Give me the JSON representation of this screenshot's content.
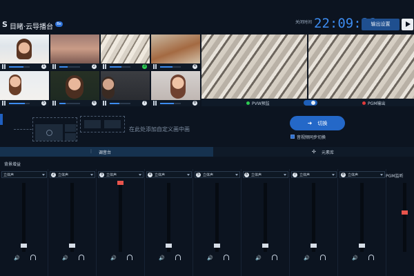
{
  "header": {
    "app_title": "目睹·云导播台",
    "beta_badge": "Be",
    "clock_label": "关闭时间",
    "clock_time": "22:09:32",
    "output_settings": "输出设置"
  },
  "monitors": {
    "pvw_label": "PVW预监",
    "pgm_label": "PGM输出"
  },
  "transition": {
    "hint": "在此处添加自定义画中画",
    "switch_label": "切换",
    "sync_label": "音视频同步切换"
  },
  "tabs": {
    "mixer": "调音台",
    "library": "元素库"
  },
  "mixer": {
    "bg_gain": "背景增益",
    "pgm_monitor": "PGM监听",
    "channels": [
      {
        "num": "1",
        "label": "立体声"
      },
      {
        "num": "2",
        "label": "立体声"
      },
      {
        "num": "3",
        "label": "立体声"
      },
      {
        "num": "4",
        "label": "立体声"
      },
      {
        "num": "5",
        "label": "立体声"
      },
      {
        "num": "6",
        "label": "立体声"
      },
      {
        "num": "7",
        "label": "立体声"
      },
      {
        "num": "8",
        "label": "立体声"
      }
    ]
  },
  "sources": [
    {
      "num": "1"
    },
    {
      "num": "2"
    },
    {
      "num": "3"
    },
    {
      "num": "4"
    },
    {
      "num": "5"
    },
    {
      "num": "6"
    },
    {
      "num": "7"
    },
    {
      "num": "8"
    }
  ],
  "colors": {
    "accent": "#2468c8",
    "clock": "#3d8cf0",
    "pvw_dot": "#2ecc52",
    "pgm_dot": "#e03a3a"
  }
}
